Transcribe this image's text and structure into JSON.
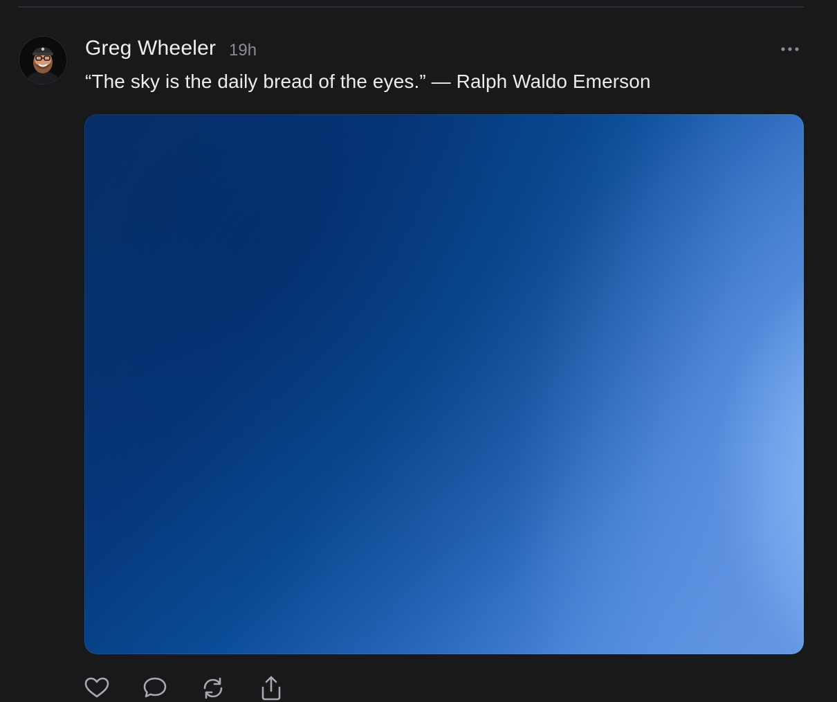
{
  "post": {
    "author": "Greg Wheeler",
    "time": "19h",
    "text": "“The sky is the daily bread of the eyes.” — Ralph Waldo Emerson"
  },
  "icons": {
    "avatar": "user-avatar-photo",
    "more": "more-horizontal-icon",
    "like": "heart-icon",
    "reply": "comment-icon",
    "repost": "repost-icon",
    "share": "share-icon"
  },
  "colors": {
    "background": "#18191b",
    "text": "#ececec",
    "muted": "#8b8c90",
    "divider": "#2e2f32"
  }
}
